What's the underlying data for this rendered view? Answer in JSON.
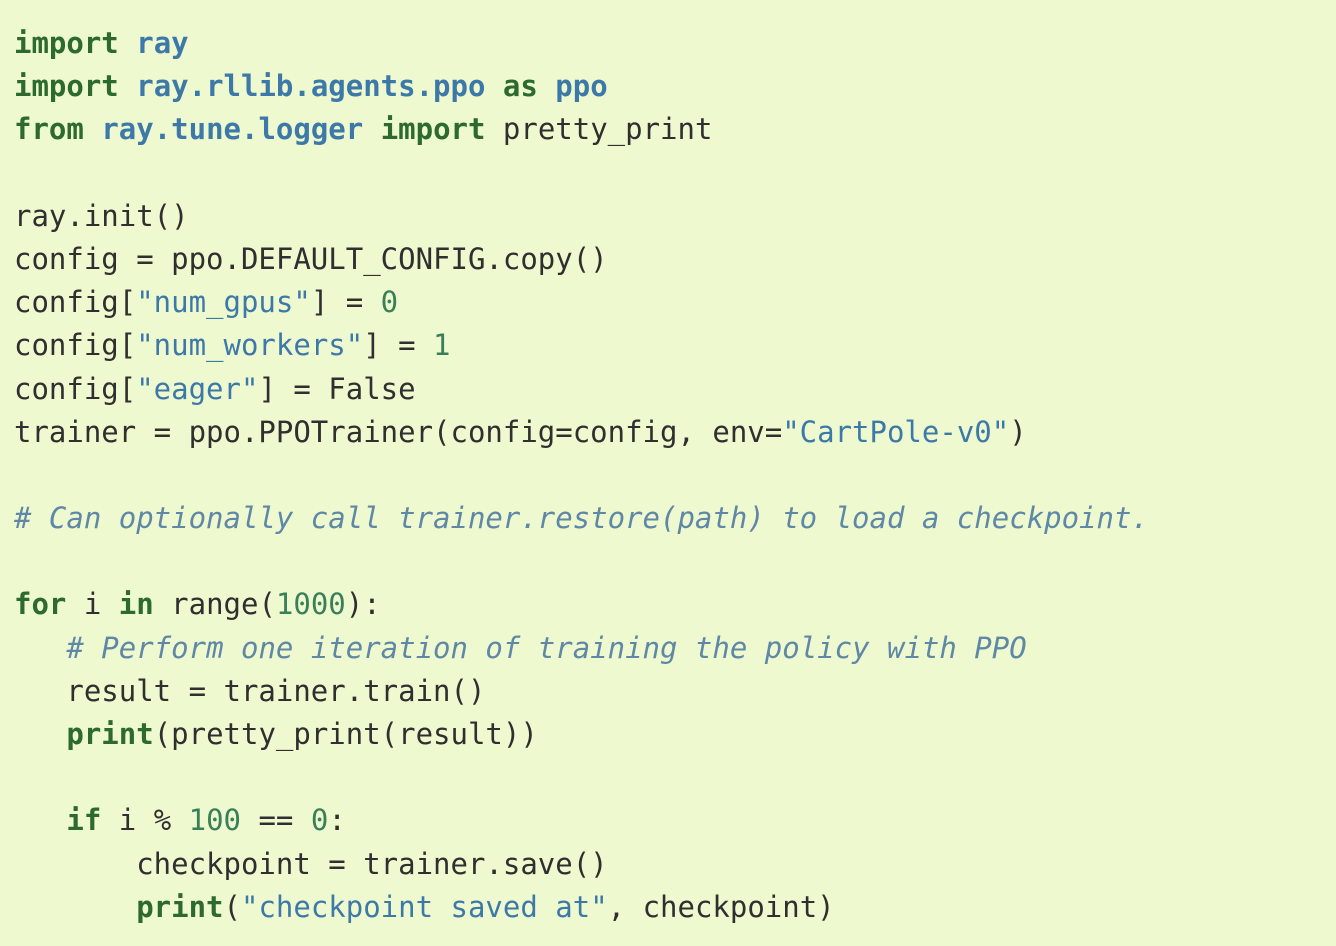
{
  "theme": {
    "background": "#eef9cf",
    "keyword_color": "#2d6a2d",
    "module_color": "#3d79a8",
    "string_color": "#3d79a8",
    "number_color": "#3a7f5a",
    "comment_color": "#5f87a6",
    "text_color": "#2f2f2f"
  },
  "code": {
    "language": "python",
    "lines": [
      {
        "tokens": [
          {
            "text": "import",
            "type": "kw"
          },
          {
            "text": " ",
            "type": "plain"
          },
          {
            "text": "ray",
            "type": "mod"
          }
        ]
      },
      {
        "tokens": [
          {
            "text": "import",
            "type": "kw"
          },
          {
            "text": " ",
            "type": "plain"
          },
          {
            "text": "ray.rllib.agents.ppo",
            "type": "mod"
          },
          {
            "text": " ",
            "type": "plain"
          },
          {
            "text": "as",
            "type": "kw"
          },
          {
            "text": " ",
            "type": "plain"
          },
          {
            "text": "ppo",
            "type": "mod"
          }
        ]
      },
      {
        "tokens": [
          {
            "text": "from",
            "type": "kw"
          },
          {
            "text": " ",
            "type": "plain"
          },
          {
            "text": "ray.tune.logger",
            "type": "mod"
          },
          {
            "text": " ",
            "type": "plain"
          },
          {
            "text": "import",
            "type": "kw"
          },
          {
            "text": " pretty_print",
            "type": "plain"
          }
        ]
      },
      {
        "tokens": []
      },
      {
        "tokens": [
          {
            "text": "ray.init()",
            "type": "plain"
          }
        ]
      },
      {
        "tokens": [
          {
            "text": "config = ppo.DEFAULT_CONFIG.copy()",
            "type": "plain"
          }
        ]
      },
      {
        "tokens": [
          {
            "text": "config[",
            "type": "plain"
          },
          {
            "text": "\"num_gpus\"",
            "type": "str"
          },
          {
            "text": "] = ",
            "type": "plain"
          },
          {
            "text": "0",
            "type": "num"
          }
        ]
      },
      {
        "tokens": [
          {
            "text": "config[",
            "type": "plain"
          },
          {
            "text": "\"num_workers\"",
            "type": "str"
          },
          {
            "text": "] = ",
            "type": "plain"
          },
          {
            "text": "1",
            "type": "num"
          }
        ]
      },
      {
        "tokens": [
          {
            "text": "config[",
            "type": "plain"
          },
          {
            "text": "\"eager\"",
            "type": "str"
          },
          {
            "text": "] = False",
            "type": "plain"
          }
        ]
      },
      {
        "tokens": [
          {
            "text": "trainer = ppo.PPOTrainer(config=config, env=",
            "type": "plain"
          },
          {
            "text": "\"CartPole-v0\"",
            "type": "str"
          },
          {
            "text": ")",
            "type": "plain"
          }
        ]
      },
      {
        "tokens": []
      },
      {
        "tokens": [
          {
            "text": "# Can optionally call trainer.restore(path) to load a checkpoint.",
            "type": "cmt"
          }
        ]
      },
      {
        "tokens": []
      },
      {
        "tokens": [
          {
            "text": "for",
            "type": "kw"
          },
          {
            "text": " i ",
            "type": "plain"
          },
          {
            "text": "in",
            "type": "kw"
          },
          {
            "text": " range(",
            "type": "plain"
          },
          {
            "text": "1000",
            "type": "num"
          },
          {
            "text": "):",
            "type": "plain"
          }
        ]
      },
      {
        "tokens": [
          {
            "text": "   ",
            "type": "plain"
          },
          {
            "text": "# Perform one iteration of training the policy with PPO",
            "type": "cmt"
          }
        ]
      },
      {
        "tokens": [
          {
            "text": "   result = trainer.train()",
            "type": "plain"
          }
        ]
      },
      {
        "tokens": [
          {
            "text": "   ",
            "type": "plain"
          },
          {
            "text": "print",
            "type": "kw"
          },
          {
            "text": "(pretty_print(result))",
            "type": "plain"
          }
        ]
      },
      {
        "tokens": []
      },
      {
        "tokens": [
          {
            "text": "   ",
            "type": "plain"
          },
          {
            "text": "if",
            "type": "kw"
          },
          {
            "text": " i % ",
            "type": "plain"
          },
          {
            "text": "100",
            "type": "num"
          },
          {
            "text": " == ",
            "type": "plain"
          },
          {
            "text": "0",
            "type": "num"
          },
          {
            "text": ":",
            "type": "plain"
          }
        ]
      },
      {
        "tokens": [
          {
            "text": "       checkpoint = trainer.save()",
            "type": "plain"
          }
        ]
      },
      {
        "tokens": [
          {
            "text": "       ",
            "type": "plain"
          },
          {
            "text": "print",
            "type": "kw"
          },
          {
            "text": "(",
            "type": "plain"
          },
          {
            "text": "\"checkpoint saved at\"",
            "type": "str"
          },
          {
            "text": ", checkpoint)",
            "type": "plain"
          }
        ]
      }
    ]
  }
}
